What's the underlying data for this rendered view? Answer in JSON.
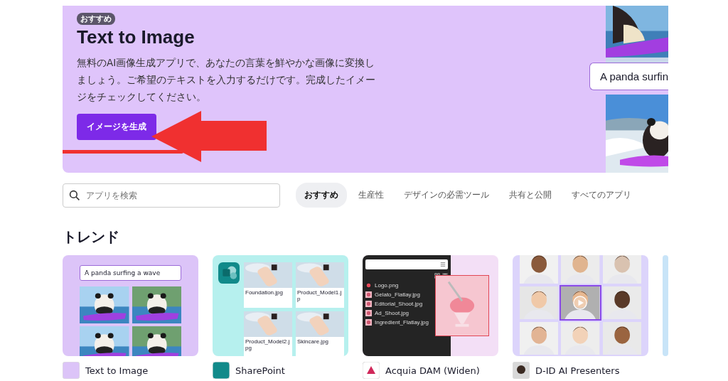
{
  "banner": {
    "badge": "おすすめ",
    "title": "Text to Image",
    "description": "無料のAI画像生成アプリで、あなたの言葉を鮮やかな画像に変換しましょう。ご希望のテキストを入力するだけです。完成したイメージをチェックしてください。",
    "button": "イメージを生成",
    "preview_prompt": "A panda surfin"
  },
  "search": {
    "placeholder": "アプリを検索"
  },
  "tabs": [
    {
      "label": "おすすめ",
      "selected": true
    },
    {
      "label": "生産性",
      "selected": false
    },
    {
      "label": "デザインの必需ツール",
      "selected": false
    },
    {
      "label": "共有と公開",
      "selected": false
    },
    {
      "label": "すべてのアプリ",
      "selected": false
    }
  ],
  "section_title": "トレンド",
  "apps": [
    {
      "kind": "prompt",
      "name": "Text to Image",
      "prompt": "A panda surfing a wave"
    },
    {
      "kind": "files",
      "name": "SharePoint",
      "files": [
        "Foundation.jpg",
        "Product_Model1.jp",
        "Product_Model2.jpg",
        "Skincare.jpg"
      ]
    },
    {
      "kind": "dam",
      "name": "Acquia DAM (Widen)",
      "files": [
        "Logo.png",
        "Gelato_Flatlay.jpg",
        "Editorial_Shoot.jpg",
        "Ad_Shoot.jpg",
        "Ingredient_Flatlay.jpg"
      ]
    },
    {
      "kind": "faces",
      "name": "D-ID AI Presenters"
    },
    {
      "kind": "partial"
    }
  ]
}
